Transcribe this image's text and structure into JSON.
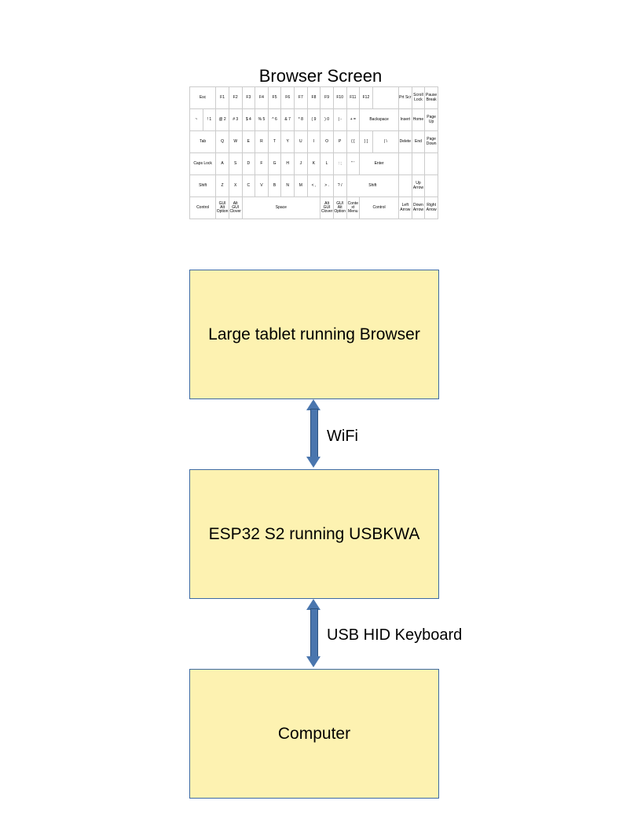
{
  "title": "Browser Screen",
  "keyboard": {
    "row0": [
      "Esc",
      "F1",
      "F2",
      "F3",
      "F4",
      "F5",
      "F6",
      "F7",
      "F8",
      "F9",
      "F10",
      "F11",
      "F12",
      "",
      "Prt Scr",
      "Scroll Lock",
      "Pause Break"
    ],
    "row1": [
      "~",
      "! 1",
      "@ 2",
      "# 3",
      "$ 4",
      "% 5",
      "^ 6",
      "& 7",
      "* 8",
      "( 9",
      ") 0",
      "| -",
      "+ =",
      "Backspace",
      "Insert",
      "Home",
      "Page Up"
    ],
    "row2": [
      "Tab",
      "Q",
      "W",
      "E",
      "R",
      "T",
      "Y",
      "U",
      "I",
      "O",
      "P",
      "{ [",
      "} ]",
      "| \\",
      "Delete",
      "End",
      "Page Down"
    ],
    "row3": [
      "Caps Lock",
      "A",
      "S",
      "D",
      "F",
      "G",
      "H",
      "J",
      "K",
      "L",
      ": ;",
      "\" '",
      "Enter",
      "",
      "",
      ""
    ],
    "row4": [
      "Shift",
      "Z",
      "X",
      "C",
      "V",
      "B",
      "N",
      "M",
      "< ,",
      "> .",
      "? /",
      "Shift",
      "",
      "Up Arrow",
      ""
    ],
    "row5": [
      "Control",
      "GUI Alt Option",
      "Alt GUI Clover",
      "Space",
      "Alt GUI Clover",
      "GUI Alt Option",
      "Context Menu",
      "Control",
      "Left Arrow",
      "Down Arrow",
      "Right Arrow"
    ]
  },
  "boxes": {
    "tablet": "Large tablet running Browser",
    "esp": "ESP32 S2 running USBKWA",
    "computer": "Computer"
  },
  "links": {
    "wifi": "WiFi",
    "usb": "USB HID Keyboard"
  }
}
